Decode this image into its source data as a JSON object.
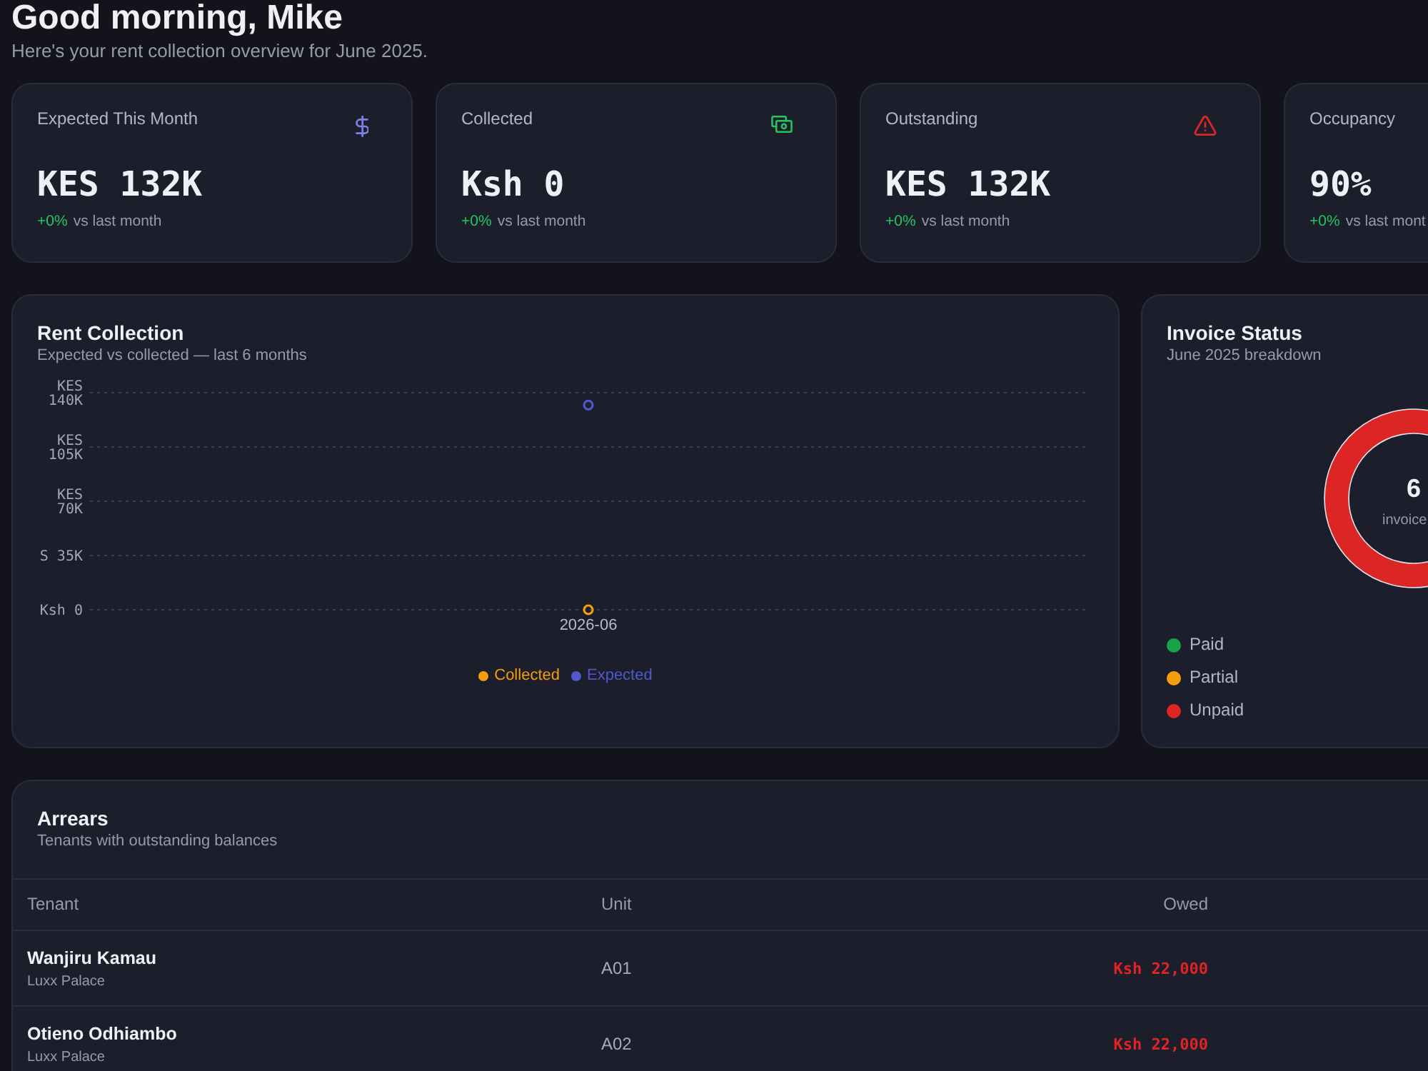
{
  "header": {
    "greeting": "Good morning, Mike",
    "subtitle": "Here's your rent collection overview for June 2025."
  },
  "stats": [
    {
      "kind": "expected",
      "label": "Expected This Month",
      "value": "KES 132K",
      "change": "+0%",
      "change_note": "vs last month"
    },
    {
      "kind": "collected",
      "label": "Collected",
      "value": "Ksh 0",
      "change": "+0%",
      "change_note": "vs last month"
    },
    {
      "kind": "outstanding",
      "label": "Outstanding",
      "value": "KES 132K",
      "change": "+0%",
      "change_note": "vs last month"
    },
    {
      "kind": "occupancy",
      "label": "Occupancy",
      "value": "90%",
      "change": "+0%",
      "change_note": "vs last mont"
    }
  ],
  "rent_collection": {
    "title": "Rent Collection",
    "subtitle": "Expected vs collected — last 6 months",
    "ytick_prefixes": [
      "KES",
      "KES",
      "KES",
      "S",
      "Ksh"
    ],
    "chart_data": {
      "type": "line",
      "categories": [
        "2026-06"
      ],
      "series": [
        {
          "name": "Collected",
          "color": "#f59e0b",
          "marker": "circle",
          "values": [
            0
          ]
        },
        {
          "name": "Expected",
          "color": "#5058cc",
          "marker": "circle",
          "values": [
            132000
          ]
        }
      ],
      "ylim": [
        0,
        140000
      ],
      "yticks": [
        {
          "value": 0,
          "label": "0"
        },
        {
          "value": 35000,
          "label": "35K"
        },
        {
          "value": 70000,
          "label": "70K"
        },
        {
          "value": 105000,
          "label": "105K"
        },
        {
          "value": 140000,
          "label": "140K"
        }
      ],
      "grid": true,
      "legend": "bottom"
    }
  },
  "invoice_status": {
    "title": "Invoice Status",
    "subtitle": "June 2025 breakdown",
    "total": "6",
    "total_label": "invoice",
    "legend": [
      {
        "label": "Paid",
        "color": "#16a34a"
      },
      {
        "label": "Partial",
        "color": "#f59e0b"
      },
      {
        "label": "Unpaid",
        "color": "#dc2626"
      }
    ]
  },
  "arrears": {
    "title": "Arrears",
    "subtitle": "Tenants with outstanding balances",
    "columns": [
      "Tenant",
      "Unit",
      "Owed"
    ],
    "rows": [
      {
        "tenant": "Wanjiru Kamau",
        "property": "Luxx Palace",
        "unit": "A01",
        "owed": "Ksh 22,000"
      },
      {
        "tenant": "Otieno Odhiambo",
        "property": "Luxx Palace",
        "unit": "A02",
        "owed": "Ksh 22,000"
      }
    ]
  }
}
